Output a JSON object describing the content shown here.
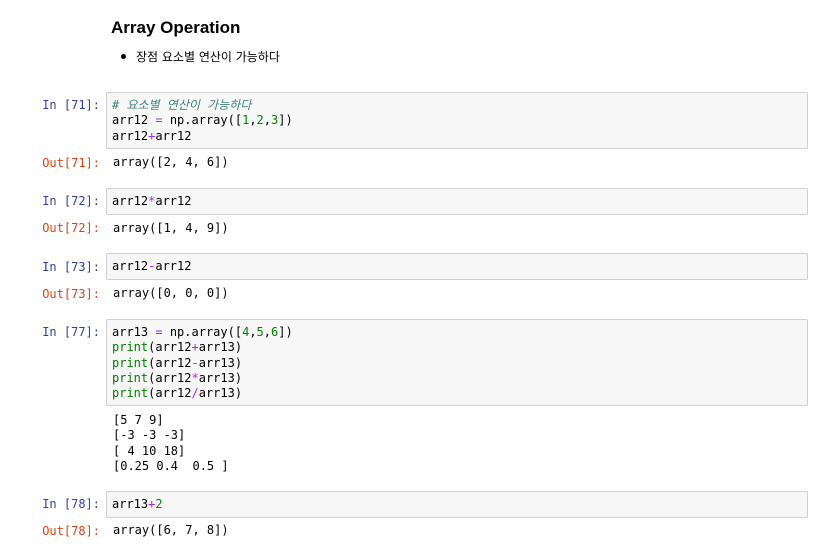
{
  "markdown": {
    "title": "Array Operation",
    "bullet": "장점 요소별 연산이 가능하다"
  },
  "cells": [
    {
      "in_prompt": "In [71]:",
      "code_lines": [
        [
          {
            "t": "# 요소별 연산이 가능하다",
            "c": "cm"
          }
        ],
        [
          {
            "t": "arr12 ",
            "c": ""
          },
          {
            "t": "=",
            "c": "op"
          },
          {
            "t": " np.array([",
            "c": ""
          },
          {
            "t": "1",
            "c": "num"
          },
          {
            "t": ",",
            "c": ""
          },
          {
            "t": "2",
            "c": "num"
          },
          {
            "t": ",",
            "c": ""
          },
          {
            "t": "3",
            "c": "num"
          },
          {
            "t": "])",
            "c": ""
          }
        ],
        [
          {
            "t": "arr12",
            "c": ""
          },
          {
            "t": "+",
            "c": "op"
          },
          {
            "t": "arr12",
            "c": ""
          }
        ]
      ],
      "out_prompt": "Out[71]:",
      "output": "array([2, 4, 6])"
    },
    {
      "in_prompt": "In [72]:",
      "code_lines": [
        [
          {
            "t": "arr12",
            "c": ""
          },
          {
            "t": "*",
            "c": "op"
          },
          {
            "t": "arr12",
            "c": ""
          }
        ]
      ],
      "out_prompt": "Out[72]:",
      "output": "array([1, 4, 9])"
    },
    {
      "in_prompt": "In [73]:",
      "code_lines": [
        [
          {
            "t": "arr12",
            "c": ""
          },
          {
            "t": "-",
            "c": "op"
          },
          {
            "t": "arr12",
            "c": ""
          }
        ]
      ],
      "out_prompt": "Out[73]:",
      "output": "array([0, 0, 0])"
    },
    {
      "in_prompt": "In [77]:",
      "code_lines": [
        [
          {
            "t": "arr13 ",
            "c": ""
          },
          {
            "t": "=",
            "c": "op"
          },
          {
            "t": " np.array([",
            "c": ""
          },
          {
            "t": "4",
            "c": "num"
          },
          {
            "t": ",",
            "c": ""
          },
          {
            "t": "5",
            "c": "num"
          },
          {
            "t": ",",
            "c": ""
          },
          {
            "t": "6",
            "c": "num"
          },
          {
            "t": "])",
            "c": ""
          }
        ],
        [
          {
            "t": "print",
            "c": "kw"
          },
          {
            "t": "(arr12",
            "c": ""
          },
          {
            "t": "+",
            "c": "op"
          },
          {
            "t": "arr13)",
            "c": ""
          }
        ],
        [
          {
            "t": "print",
            "c": "kw"
          },
          {
            "t": "(arr12",
            "c": ""
          },
          {
            "t": "-",
            "c": "op"
          },
          {
            "t": "arr13)",
            "c": ""
          }
        ],
        [
          {
            "t": "print",
            "c": "kw"
          },
          {
            "t": "(arr12",
            "c": ""
          },
          {
            "t": "*",
            "c": "op"
          },
          {
            "t": "arr13)",
            "c": ""
          }
        ],
        [
          {
            "t": "print",
            "c": "kw"
          },
          {
            "t": "(arr12",
            "c": ""
          },
          {
            "t": "/",
            "c": "op"
          },
          {
            "t": "arr13)",
            "c": ""
          }
        ]
      ],
      "out_prompt": "",
      "output": "[5 7 9]\n[-3 -3 -3]\n[ 4 10 18]\n[0.25 0.4  0.5 ]"
    },
    {
      "in_prompt": "In [78]:",
      "code_lines": [
        [
          {
            "t": "arr13",
            "c": ""
          },
          {
            "t": "+",
            "c": "op"
          },
          {
            "t": "2",
            "c": "num"
          }
        ]
      ],
      "out_prompt": "Out[78]:",
      "output": "array([6, 7, 8])"
    }
  ]
}
